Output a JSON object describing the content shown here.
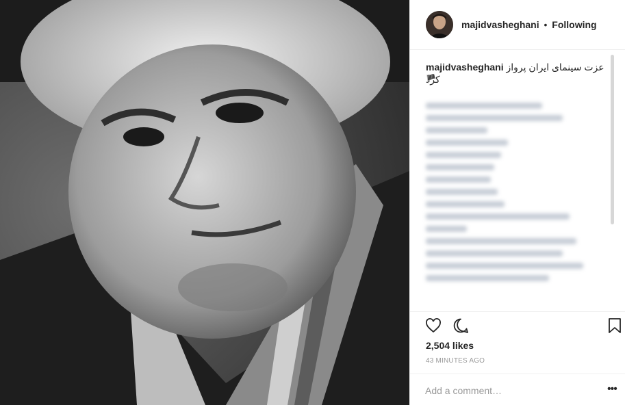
{
  "post": {
    "image_alt": "Black and white portrait of an elderly man",
    "header": {
      "username": "majidvasheghani",
      "separator": "•",
      "follow_status": "Following"
    },
    "caption": {
      "username": "majidvasheghani",
      "text": "عزت سینمای ایران پرواز کرد",
      "emoji": "🏴"
    },
    "likes": "2,504 likes",
    "timestamp": "43 MINUTES AGO",
    "comment_placeholder": "Add a comment…",
    "more_label": "•••"
  },
  "icons": {
    "like": "heart-icon",
    "comment": "comment-icon",
    "save": "bookmark-icon",
    "more": "more-options-icon",
    "flag": "black-flag-icon"
  },
  "colors": {
    "text": "#262626",
    "muted": "#999999",
    "border": "#efefef",
    "blurred_text": "#9aa5b6"
  }
}
